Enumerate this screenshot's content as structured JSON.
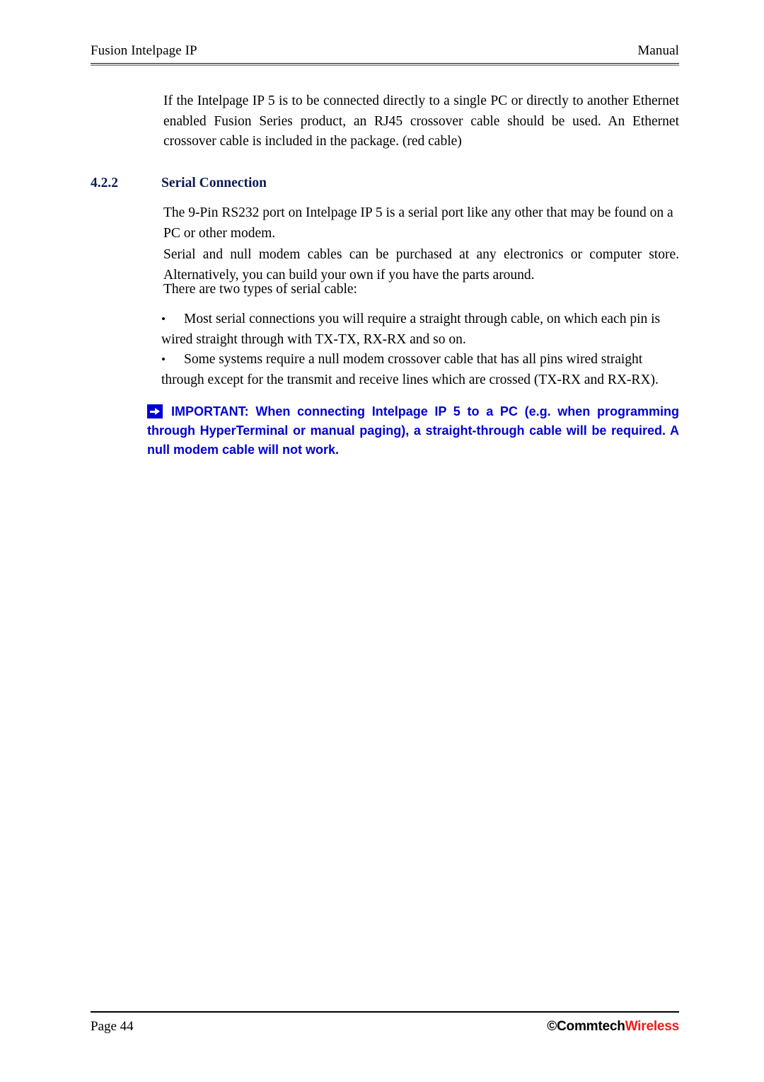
{
  "header": {
    "left": "Fusion Intelpage IP",
    "right": "Manual"
  },
  "body": {
    "intro_paragraph": "If the Intelpage IP 5 is to be connected directly to a single PC or directly to another Ethernet enabled Fusion Series product, an RJ45 crossover cable should be used. An Ethernet crossover cable is included in the package. (red cable)",
    "section": {
      "number": "4.2.2",
      "title": "Serial Connection",
      "color": "#0d1b56"
    },
    "paragraph_1": "The 9-Pin RS232 port on Intelpage IP 5 is a serial port like any other that may be found on a PC or other modem.",
    "paragraph_2": "Serial and null modem cables can be purchased at any electronics or computer store. Alternatively, you can build your own if you have the parts around.",
    "paragraph_3": "There are two types of serial cable:",
    "bullet_mark": "•",
    "bullets": [
      "Most serial connections you will require a straight through cable, on which each pin is wired straight through with TX-TX, RX-RX and so on.",
      "Some systems require a null modem crossover cable that has all pins wired straight through except for the transmit and receive lines which are crossed (TX-RX and RX-RX)."
    ],
    "important": {
      "icon": "right-arrow-icon",
      "color": "#0000d4",
      "text": "IMPORTANT: When connecting Intelpage IP 5 to a PC (e.g. when programming through HyperTerminal or manual paging), a straight-through cable will be required. A null modem cable will not work."
    }
  },
  "footer": {
    "page_label": "Page 44",
    "copyright_mark": "©",
    "brand_first": "Commtech",
    "brand_second": "Wireless",
    "brand_second_color": "#ee1b1b"
  }
}
